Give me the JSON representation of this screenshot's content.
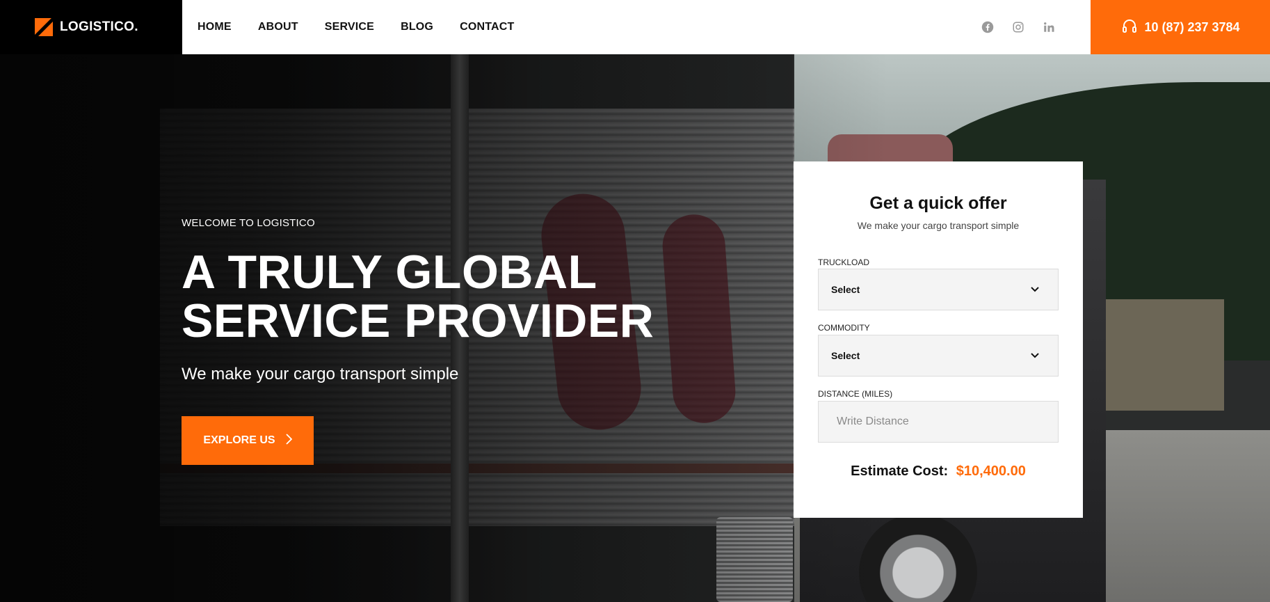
{
  "brand": {
    "name": "LOGISTICO.",
    "accent": "#ff6b0a"
  },
  "nav": {
    "items": [
      {
        "label": "HOME"
      },
      {
        "label": "ABOUT"
      },
      {
        "label": "SERVICE"
      },
      {
        "label": "BLOG"
      },
      {
        "label": "CONTACT"
      }
    ]
  },
  "social": {
    "icons": [
      "facebook-icon",
      "instagram-icon",
      "linkedin-icon"
    ]
  },
  "contact": {
    "phone": "10 (87) 237 3784",
    "icon": "headphones-icon"
  },
  "hero": {
    "welcome": "WELCOME TO LOGISTICO",
    "headline_line1": "A TRULY GLOBAL",
    "headline_line2": "SERVICE PROVIDER",
    "subhead": "We make your cargo transport simple",
    "cta_label": "EXPLORE US"
  },
  "offer": {
    "title": "Get a quick offer",
    "subtitle": "We make your cargo transport simple",
    "truckload_label": "TRUCKLOAD",
    "truckload_value": "Select",
    "commodity_label": "COMMODITY",
    "commodity_value": "Select",
    "distance_label": "DISTANCE (MILES)",
    "distance_placeholder": "Write Distance",
    "estimate_label": "Estimate Cost:",
    "estimate_value": "$10,400.00"
  }
}
